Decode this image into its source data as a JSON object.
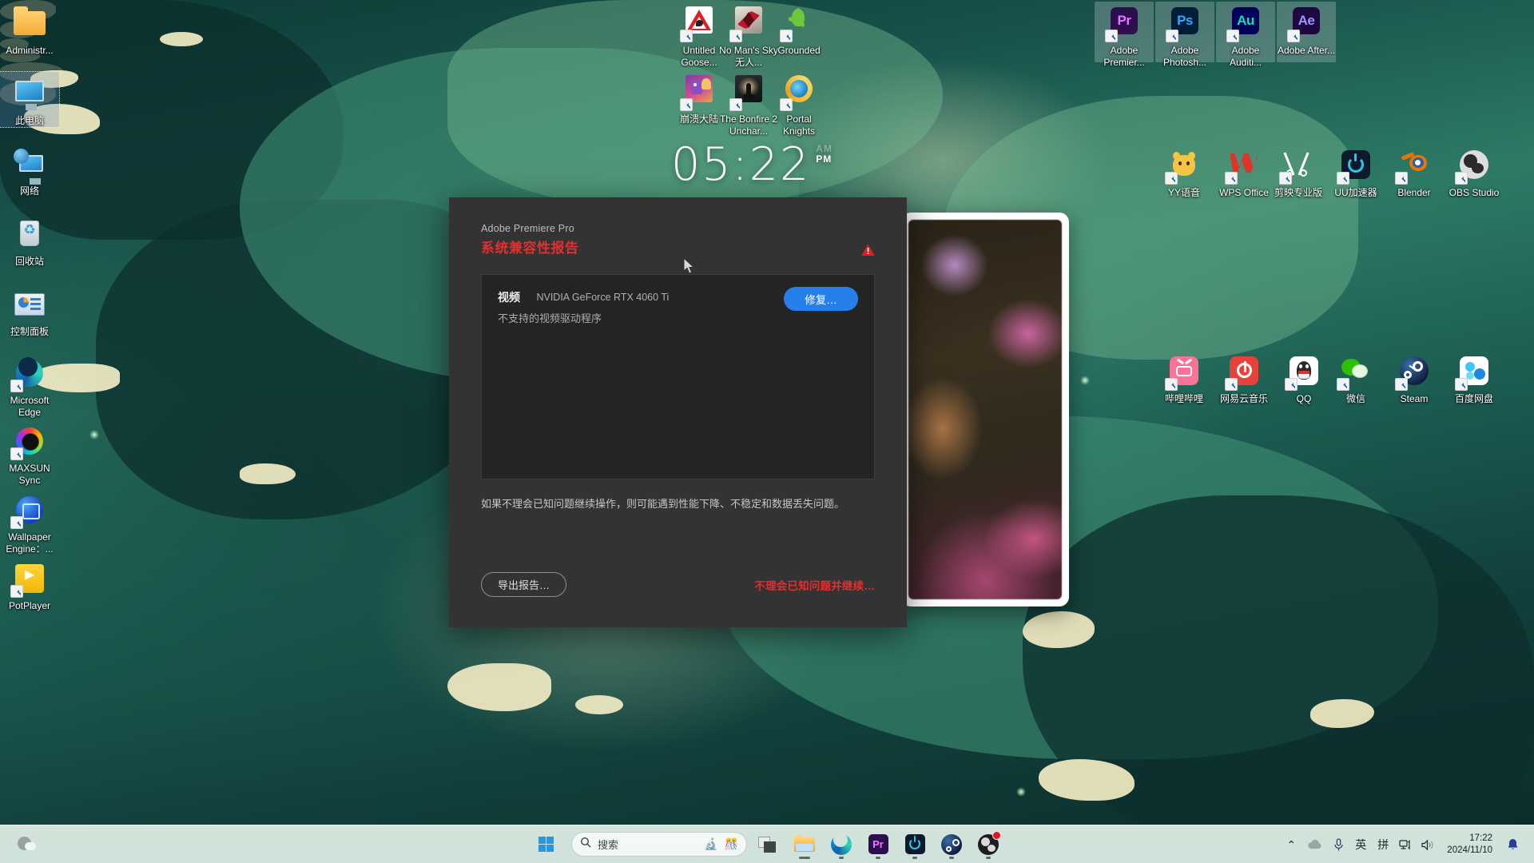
{
  "desktop": {
    "left_column": [
      {
        "label": "Administr...",
        "icon": "folder-icon",
        "selected": false
      },
      {
        "label": "此电脑",
        "icon": "this-pc-icon",
        "selected": true
      },
      {
        "label": "网络",
        "icon": "network-icon",
        "selected": false
      },
      {
        "label": "回收站",
        "icon": "recycle-bin-icon",
        "selected": false
      },
      {
        "label": "控制面板",
        "icon": "control-panel-icon",
        "selected": false
      },
      {
        "label": "Microsoft Edge",
        "icon": "edge-icon",
        "selected": false
      },
      {
        "label": "MAXSUN Sync",
        "icon": "maxsun-sync-icon",
        "selected": false
      },
      {
        "label": "Wallpaper Engine：...",
        "icon": "wallpaper-engine-icon",
        "selected": false
      },
      {
        "label": "PotPlayer",
        "icon": "potplayer-icon",
        "selected": false
      }
    ],
    "games": [
      {
        "label": "Untitled Goose...",
        "icon": "untitled-goose-game-icon"
      },
      {
        "label": "No Man's Sky 无人...",
        "icon": "no-mans-sky-icon"
      },
      {
        "label": "Grounded",
        "icon": "grounded-icon"
      },
      {
        "label": "崩溃大陆",
        "icon": "crashlands-icon"
      },
      {
        "label": "The Bonfire 2 Unchar...",
        "icon": "bonfire-2-icon"
      },
      {
        "label": "Portal Knights",
        "icon": "portal-knights-icon"
      }
    ],
    "adobe_apps": [
      {
        "label": "Adobe Premier...",
        "abbr": "Pr",
        "color": "#2d0f4e",
        "accent": "#ea77ff",
        "highlighted": true
      },
      {
        "label": "Adobe Photosh...",
        "abbr": "Ps",
        "color": "#001e36",
        "accent": "#31a8ff",
        "highlighted": true
      },
      {
        "label": "Adobe Auditi...",
        "abbr": "Au",
        "color": "#00005b",
        "accent": "#00e4bb",
        "highlighted": true
      },
      {
        "label": "Adobe After...",
        "abbr": "Ae",
        "color": "#1f0740",
        "accent": "#9999ff",
        "highlighted": true
      }
    ],
    "right_row_1": [
      {
        "label": "YY语音",
        "icon": "yy-voice-icon"
      },
      {
        "label": "WPS Office",
        "icon": "wps-office-icon"
      },
      {
        "label": "剪映专业版",
        "icon": "jianying-pro-icon"
      },
      {
        "label": "UU加速器",
        "icon": "uu-booster-icon"
      },
      {
        "label": "Blender",
        "icon": "blender-icon"
      },
      {
        "label": "OBS Studio",
        "icon": "obs-studio-icon"
      }
    ],
    "right_row_2": [
      {
        "label": "哔哩哔哩",
        "icon": "bilibili-icon"
      },
      {
        "label": "网易云音乐",
        "icon": "netease-music-icon"
      },
      {
        "label": "QQ",
        "icon": "qq-icon"
      },
      {
        "label": "微信",
        "icon": "wechat-icon"
      },
      {
        "label": "Steam",
        "icon": "steam-icon"
      },
      {
        "label": "百度网盘",
        "icon": "baidu-netdisk-icon"
      }
    ]
  },
  "clock_widget": {
    "time": "05:22",
    "am": "AM",
    "pm": "PM",
    "active_meridiem": "PM"
  },
  "dialog": {
    "app_name": "Adobe Premiere Pro",
    "title": "系统兼容性报告",
    "warning_icon": "warning-triangle-icon",
    "warning_color": "#e03030",
    "issue": {
      "category": "视频",
      "device": "NVIDIA GeForce RTX 4060 Ti",
      "description": "不支持的视频驱动程序",
      "fix_label": "修复…",
      "fix_color": "#2680eb"
    },
    "note": "如果不理会已知问题继续操作，则可能遇到性能下降、不稳定和数据丢失问题。",
    "export_label": "导出报告…",
    "ignore_label": "不理会已知问题并继续…"
  },
  "taskbar": {
    "weather_icon": "weather-cloud-icon",
    "start_label": "start-button",
    "search_placeholder": "搜索",
    "search_right_icons": [
      "microscope-icon",
      "confetti-icon"
    ],
    "pinned": [
      {
        "name": "task-view-icon",
        "badge": false
      },
      {
        "name": "file-explorer-icon",
        "badge": false
      },
      {
        "name": "edge-icon",
        "badge": false
      },
      {
        "name": "premiere-pro-icon",
        "badge": false
      },
      {
        "name": "uu-booster-icon",
        "badge": false
      },
      {
        "name": "steam-icon",
        "badge": false
      },
      {
        "name": "obs-studio-icon",
        "badge": true
      }
    ],
    "tray": [
      {
        "name": "show-hidden-icons-chevron",
        "glyph": "⌃"
      },
      {
        "name": "onedrive-cloud-icon",
        "glyph": "☁"
      },
      {
        "name": "microphone-icon",
        "glyph": "🎤"
      },
      {
        "name": "ime-language-indicator",
        "glyph": "英"
      },
      {
        "name": "ime-pinyin-indicator",
        "glyph": "拼"
      },
      {
        "name": "network-icon",
        "glyph": "🖧"
      },
      {
        "name": "volume-icon",
        "glyph": "🔊"
      }
    ],
    "clock_time": "17:22",
    "clock_date": "2024/11/10",
    "notification_icon": "bell-icon"
  }
}
